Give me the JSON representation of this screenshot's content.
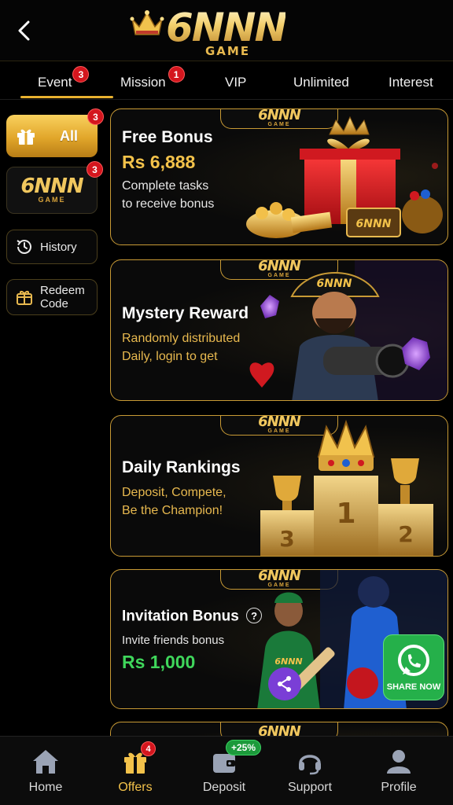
{
  "header": {
    "logo_main": "6NNN",
    "logo_sub": "GAME"
  },
  "tabs": [
    {
      "label": "Event",
      "badge": "3"
    },
    {
      "label": "Mission",
      "badge": "1"
    },
    {
      "label": "VIP"
    },
    {
      "label": "Unlimited"
    },
    {
      "label": "Interest"
    }
  ],
  "sidebar": {
    "all": {
      "label": "All",
      "badge": "3"
    },
    "brand": {
      "name": "6NNN",
      "sub": "GAME",
      "badge": "3"
    },
    "history": "History",
    "redeem": [
      "Redeem",
      "Code"
    ]
  },
  "cards": [
    {
      "title": "Free Bonus",
      "amount": "Rs 6,888",
      "lines": [
        "Complete tasks",
        "to receive bonus"
      ],
      "brand": "6NNN",
      "brand_sub": "GAME"
    },
    {
      "title": "Mystery Reward",
      "lines": [
        "Randomly distributed",
        "Daily, login to get"
      ],
      "brand": "6NNN",
      "brand_sub": "GAME"
    },
    {
      "title": "Daily Rankings",
      "lines": [
        "Deposit, Compete,",
        "Be the Champion!"
      ],
      "brand": "6NNN",
      "brand_sub": "GAME",
      "podium": [
        "1",
        "2",
        "3"
      ]
    },
    {
      "title": "Invitation Bonus",
      "subtitle": "Invite friends bonus",
      "amount": "Rs 1,000",
      "brand": "6NNN",
      "brand_sub": "GAME",
      "share_label": "SHARE NOW",
      "help": "?"
    },
    {
      "brand": "6NNN"
    }
  ],
  "bottom_nav": [
    {
      "label": "Home",
      "icon": "home-icon"
    },
    {
      "label": "Offers",
      "icon": "gift-icon",
      "badge": "4",
      "active": true
    },
    {
      "label": "Deposit",
      "icon": "wallet-icon",
      "promo": "+25%"
    },
    {
      "label": "Support",
      "icon": "headset-icon"
    },
    {
      "label": "Profile",
      "icon": "user-icon"
    }
  ],
  "colors": {
    "gold": "#e8b130",
    "badge_red": "#d4161e",
    "green": "#3fd65b",
    "background": "#000000"
  }
}
